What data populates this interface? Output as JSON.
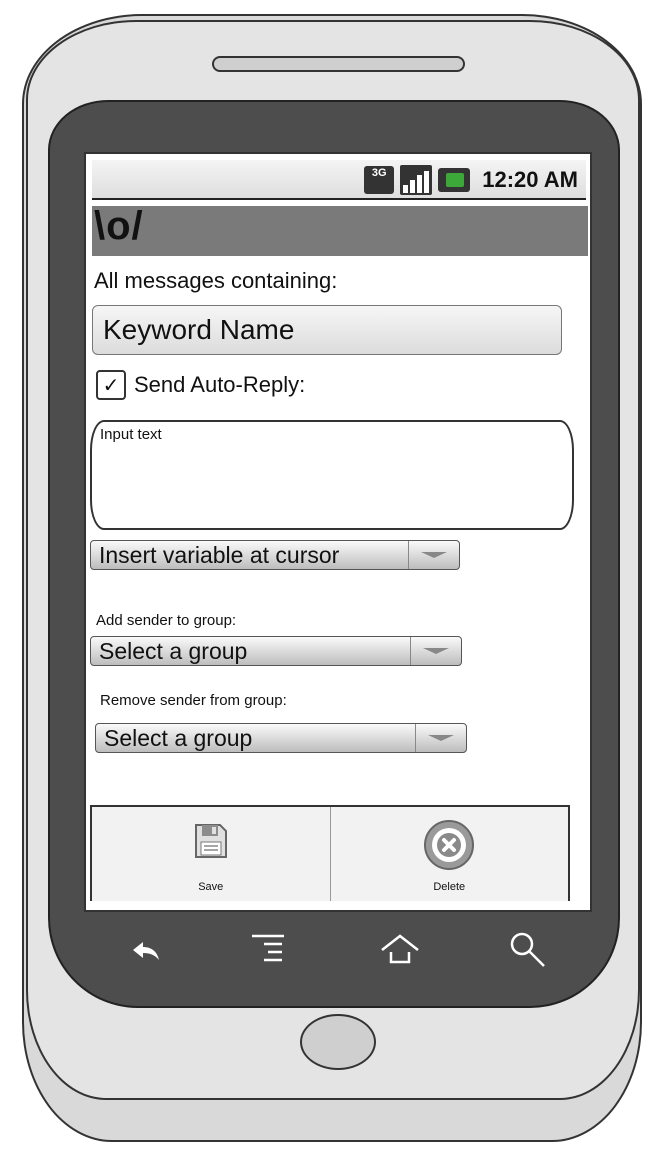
{
  "status_bar": {
    "network_label": "3G",
    "signal_bars": 4,
    "time": "12:20 AM"
  },
  "app": {
    "logo_text": "\\o/"
  },
  "form": {
    "messages_label": "All messages containing:",
    "keyword_value": "Keyword Name",
    "auto_reply": {
      "label": "Send Auto-Reply:",
      "checked": true,
      "check_mark": "✓"
    },
    "input_text_placeholder": "Input text",
    "insert_variable_select": "Insert variable at cursor",
    "add_group_label": "Add sender to group:",
    "add_group_select": "Select a group",
    "remove_group_label": "Remove sender from group:",
    "remove_group_select": "Select a group"
  },
  "actions": {
    "save_label": "Save",
    "delete_label": "Delete"
  },
  "icons": {
    "save": "floppy-disk-icon",
    "delete": "delete-x-circle-icon",
    "back": "back-arrow-icon",
    "menu": "menu-icon",
    "home": "home-icon",
    "search": "search-icon"
  },
  "colors": {
    "title_bar": "#7a7a7a",
    "bezel": "#4d4d4d",
    "battery": "#3ca83a"
  }
}
